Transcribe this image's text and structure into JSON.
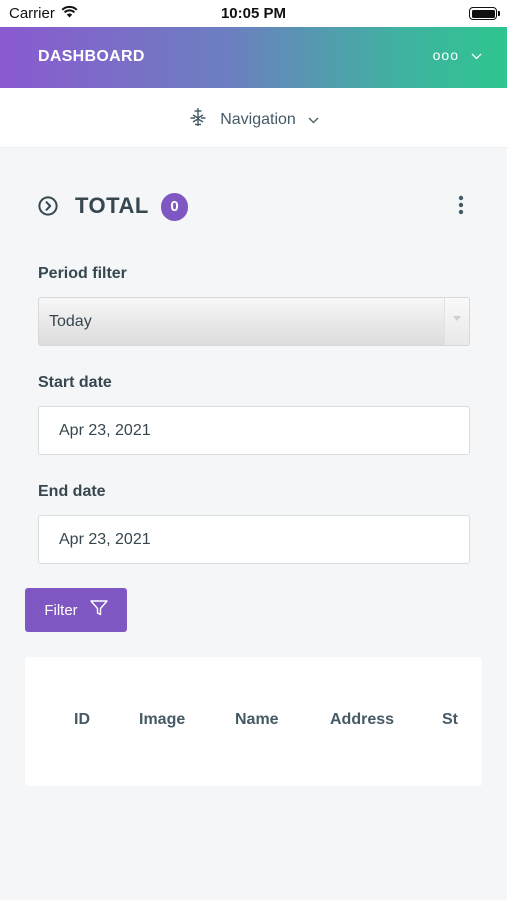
{
  "status_bar": {
    "carrier": "Carrier",
    "time": "10:05 PM"
  },
  "header": {
    "brand": "DASHBOARD",
    "user_label": "ooo"
  },
  "nav": {
    "label": "Navigation"
  },
  "total": {
    "title": "TOTAL",
    "count": "0"
  },
  "filters": {
    "period_label": "Period filter",
    "period_value": "Today",
    "start_label": "Start date",
    "start_value": "Apr 23, 2021",
    "end_label": "End date",
    "end_value": "Apr 23, 2021",
    "filter_button": "Filter"
  },
  "table": {
    "columns": [
      "ID",
      "Image",
      "Name",
      "Address",
      "St"
    ]
  },
  "icons": {
    "wifi": "wifi-icon",
    "battery": "battery-icon",
    "chevron": "chevron-down-icon",
    "nav": "navigation-icon",
    "circle_arrow": "chevron-right-circle-icon",
    "more": "more-vertical-icon",
    "filter": "filter-icon"
  },
  "colors": {
    "accent": "#7e57c2",
    "header_gradient_start": "#8a5ad0",
    "header_gradient_end": "#2ec58e"
  }
}
